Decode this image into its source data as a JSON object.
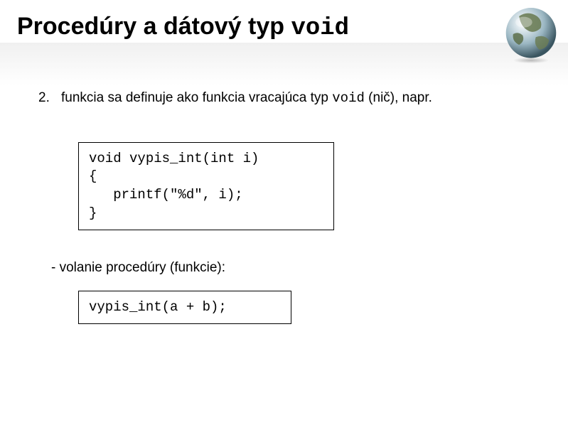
{
  "title": {
    "prefix": "Procedúry a dátový typ ",
    "code": "void"
  },
  "list": {
    "number": "2.",
    "text_before": "funkcia sa definuje ako funkcia vracajúca typ ",
    "text_code": "void",
    "text_after": " (nič), napr."
  },
  "codebox1": "void vypis_int(int i)\n{\n   printf(\"%d\", i);\n}",
  "sub": "-  volanie procedúry (funkcie):",
  "codebox2": "vypis_int(a + b);"
}
